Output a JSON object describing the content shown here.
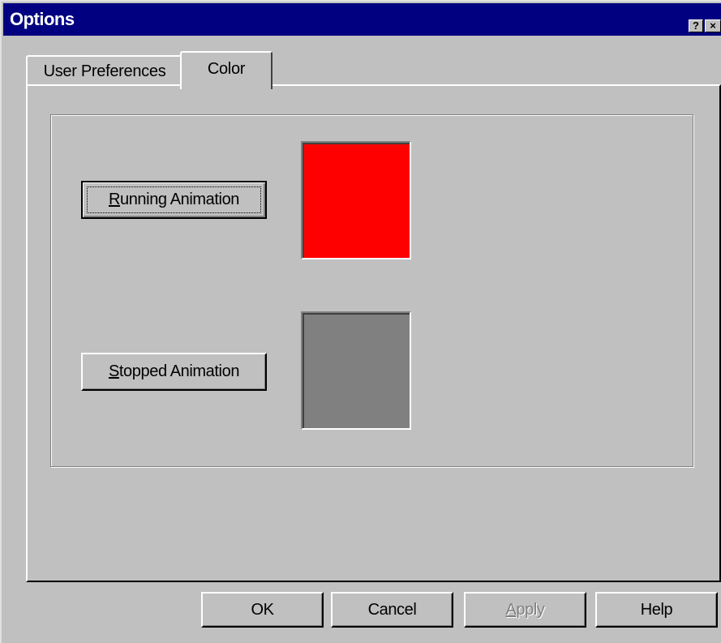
{
  "window": {
    "title": "Options",
    "help_glyph": "?",
    "close_glyph": "×"
  },
  "tabs": [
    {
      "label": "User Preferences",
      "active": false
    },
    {
      "label": "Color",
      "active": true
    }
  ],
  "color_panel": {
    "running_button": {
      "label_mnemonic": "R",
      "label_rest": "unning Animation"
    },
    "running_color": "#ff0000",
    "stopped_button": {
      "label_mnemonic": "S",
      "label_rest": "topped Animation"
    },
    "stopped_color": "#808080"
  },
  "footer": {
    "ok_label": "OK",
    "cancel_label": "Cancel",
    "apply_mnemonic": "A",
    "apply_rest": "pply",
    "help_label": "Help"
  },
  "colors": {
    "face": "#c0c0c0",
    "titlebar": "#000080"
  }
}
